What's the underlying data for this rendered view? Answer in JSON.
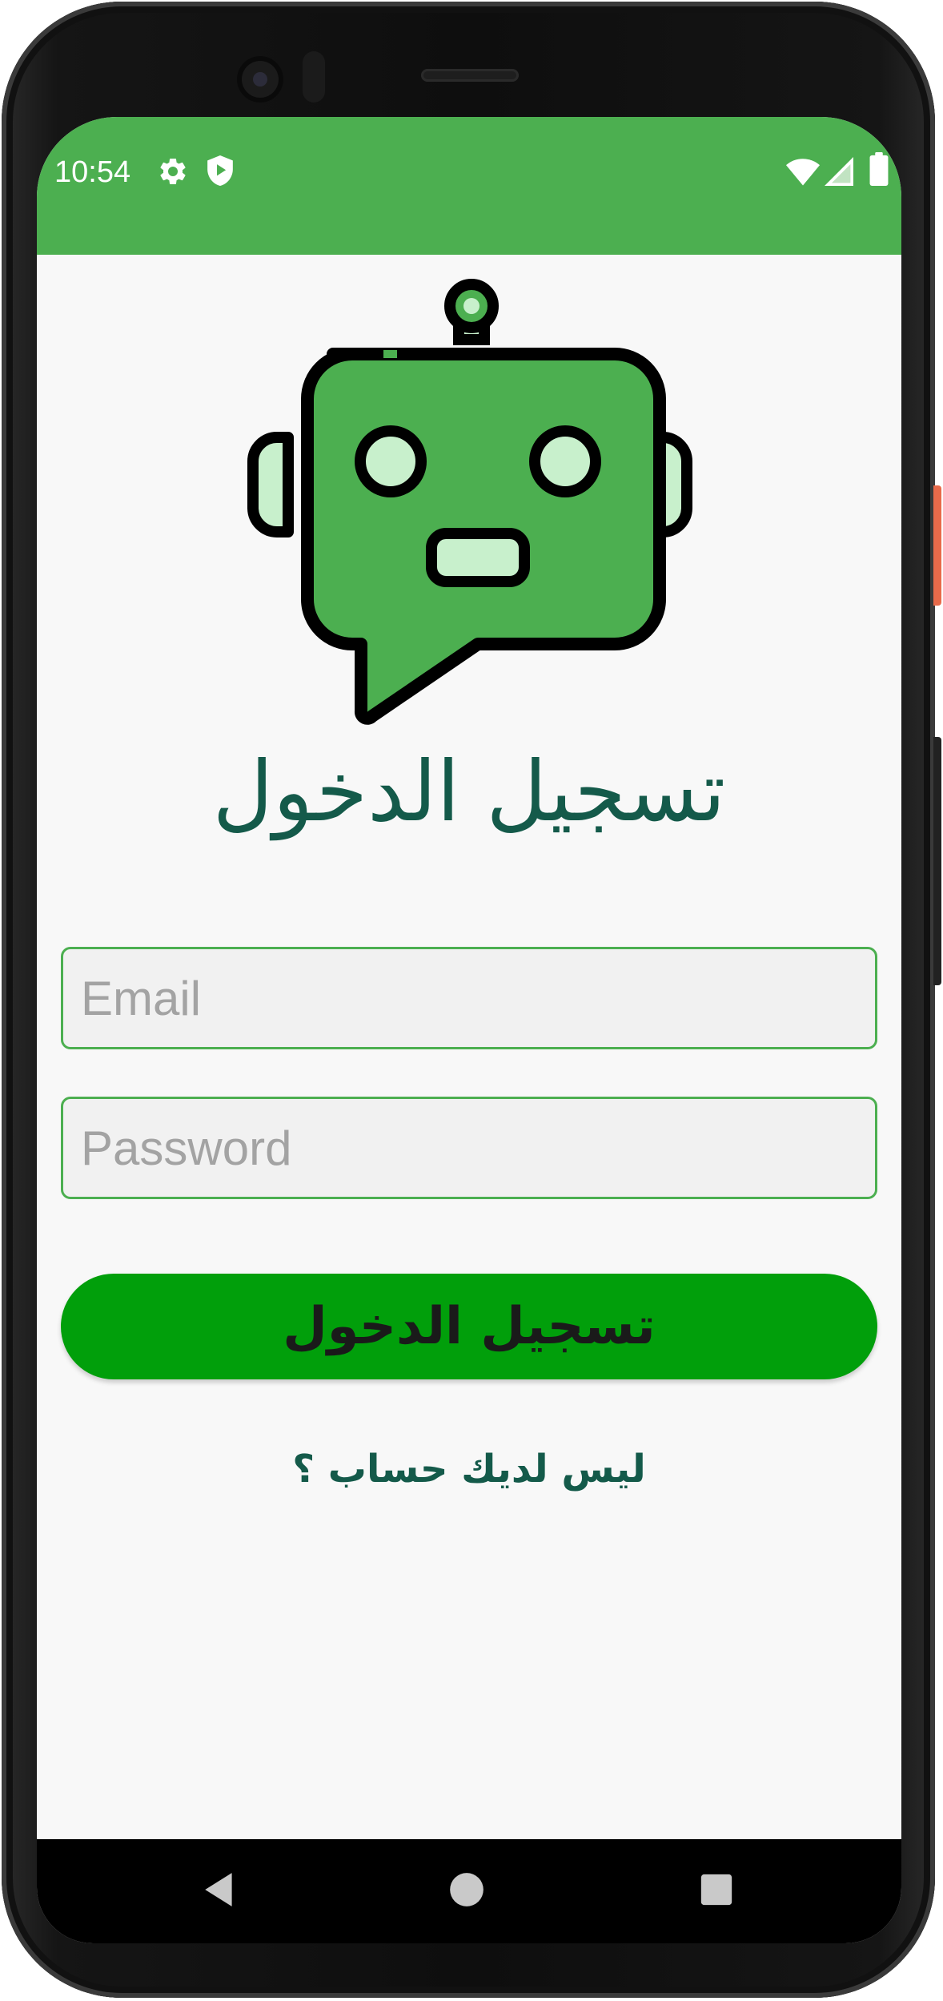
{
  "status_bar": {
    "time": "10:54",
    "icons": [
      "settings-icon",
      "shield-play-icon",
      "wifi-icon",
      "signal-icon",
      "battery-icon"
    ],
    "background": "#4caf50"
  },
  "logo": {
    "icon": "chatbot-robot-icon",
    "color": "#4caf50",
    "accent": "#c8f0cc"
  },
  "login": {
    "title": "تسجيل الدخول",
    "email_placeholder": "Email",
    "email_value": "",
    "password_placeholder": "Password",
    "password_value": "",
    "button_label": "تسجيل الدخول",
    "signup_link": "ليس لديك حساب ؟"
  },
  "colors": {
    "title_text": "#145a4a",
    "button_bg": "#019f0b",
    "field_border": "#4caf50",
    "field_bg": "#f1f1f1"
  },
  "nav_bar": {
    "buttons": [
      "back-icon",
      "home-icon",
      "recents-icon"
    ]
  }
}
